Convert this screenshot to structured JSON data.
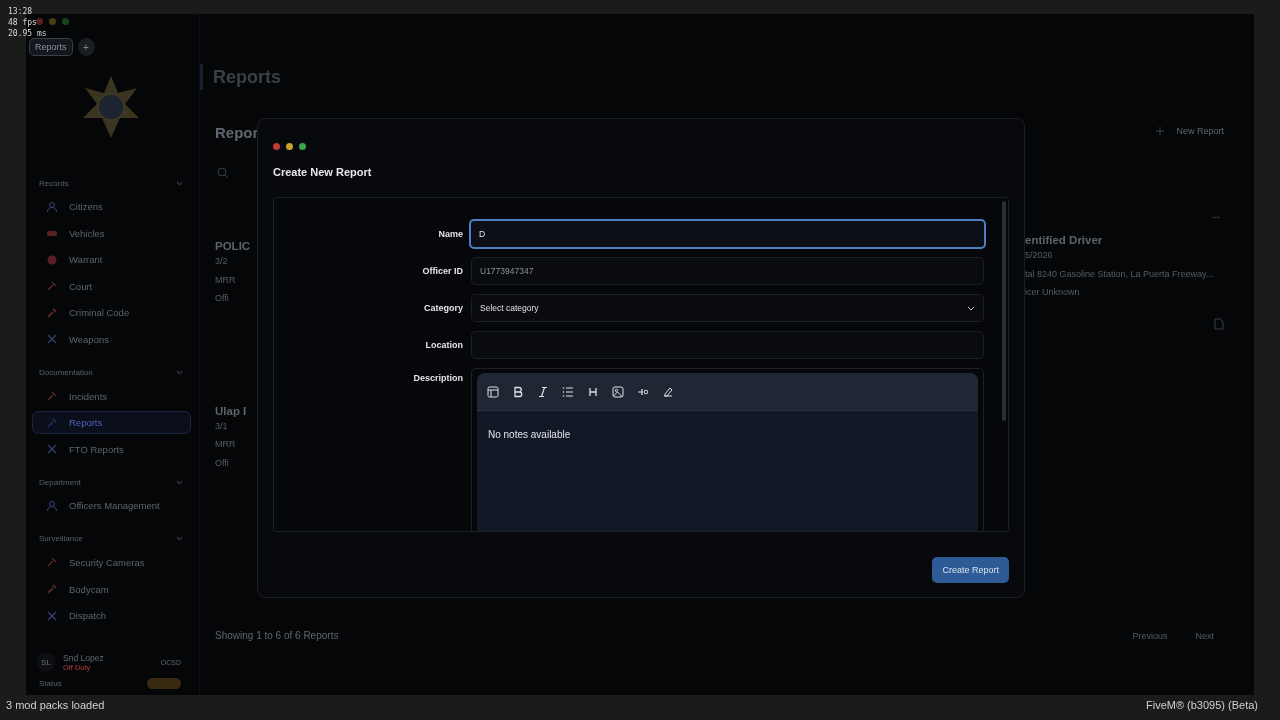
{
  "hud": {
    "time": "13:28",
    "fps": "48 fps",
    "frame_time": "20.95 ms"
  },
  "app_tabs": [
    {
      "label": "Reports",
      "selected": true
    }
  ],
  "new_tab_button": "+",
  "sidebar": {
    "sections": [
      {
        "title": "Records",
        "expanded": true,
        "items": [
          {
            "label": "Citizens",
            "selected": false
          },
          {
            "label": "Vehicles",
            "selected": false
          },
          {
            "label": "Warrant",
            "selected": false
          },
          {
            "label": "Court",
            "selected": false
          },
          {
            "label": "Criminal Code",
            "selected": false
          },
          {
            "label": "Weapons",
            "selected": false
          }
        ]
      },
      {
        "title": "Documentation",
        "expanded": true,
        "items": [
          {
            "label": "Incidents",
            "selected": false
          },
          {
            "label": "Reports",
            "selected": true
          },
          {
            "label": "FTO Reports",
            "selected": false
          }
        ]
      },
      {
        "title": "Department",
        "expanded": true,
        "items": [
          {
            "label": "Officers Management",
            "selected": false
          }
        ]
      },
      {
        "title": "Surveillance",
        "expanded": true,
        "items": [
          {
            "label": "Security Cameras",
            "selected": false
          },
          {
            "label": "Bodycam",
            "selected": false
          },
          {
            "label": "Dispatch",
            "selected": false
          }
        ]
      }
    ],
    "user": {
      "initials": "SL",
      "name": "Snd Lopez",
      "duty": "Off Duty",
      "department": "OCSD",
      "status_label": "Status"
    }
  },
  "page": {
    "title": "Reports"
  },
  "left_peek": {
    "heading": "Repor",
    "cards": [
      {
        "title": "POLIC",
        "date": "3/2",
        "location": "MRR",
        "officer": "Offi"
      },
      {
        "title": "Ulap I",
        "date": "3/1",
        "location": "MRR",
        "officer": "Offi"
      }
    ]
  },
  "right_peek": {
    "new_button": "New Report",
    "menu": "...",
    "card": {
      "title": "entified Driver",
      "date": "5/2026",
      "location": "tal 8240 Gasoline Station, La Puerta Freeway...",
      "officer": "icer Unknown"
    }
  },
  "modal": {
    "title": "Create New Report",
    "fields": [
      {
        "kind": "text",
        "label": "Name",
        "value": "D",
        "focused": true
      },
      {
        "kind": "text",
        "label": "Officer ID",
        "value": "U1773947347",
        "focused": false
      },
      {
        "kind": "select",
        "label": "Category",
        "value": "Select category",
        "focused": false
      },
      {
        "kind": "text",
        "label": "Location",
        "focused": false
      },
      {
        "kind": "editor",
        "label": "Description",
        "value": "No notes available",
        "focused": false
      }
    ],
    "submit": "Create Report"
  },
  "footer": {
    "summary": "Showing 1 to 6 of 6 Reports",
    "previous": "Previous",
    "next": "Next"
  },
  "client": {
    "mods": "3 mod packs loaded",
    "version": "FiveM® (b3095) (Beta)"
  }
}
